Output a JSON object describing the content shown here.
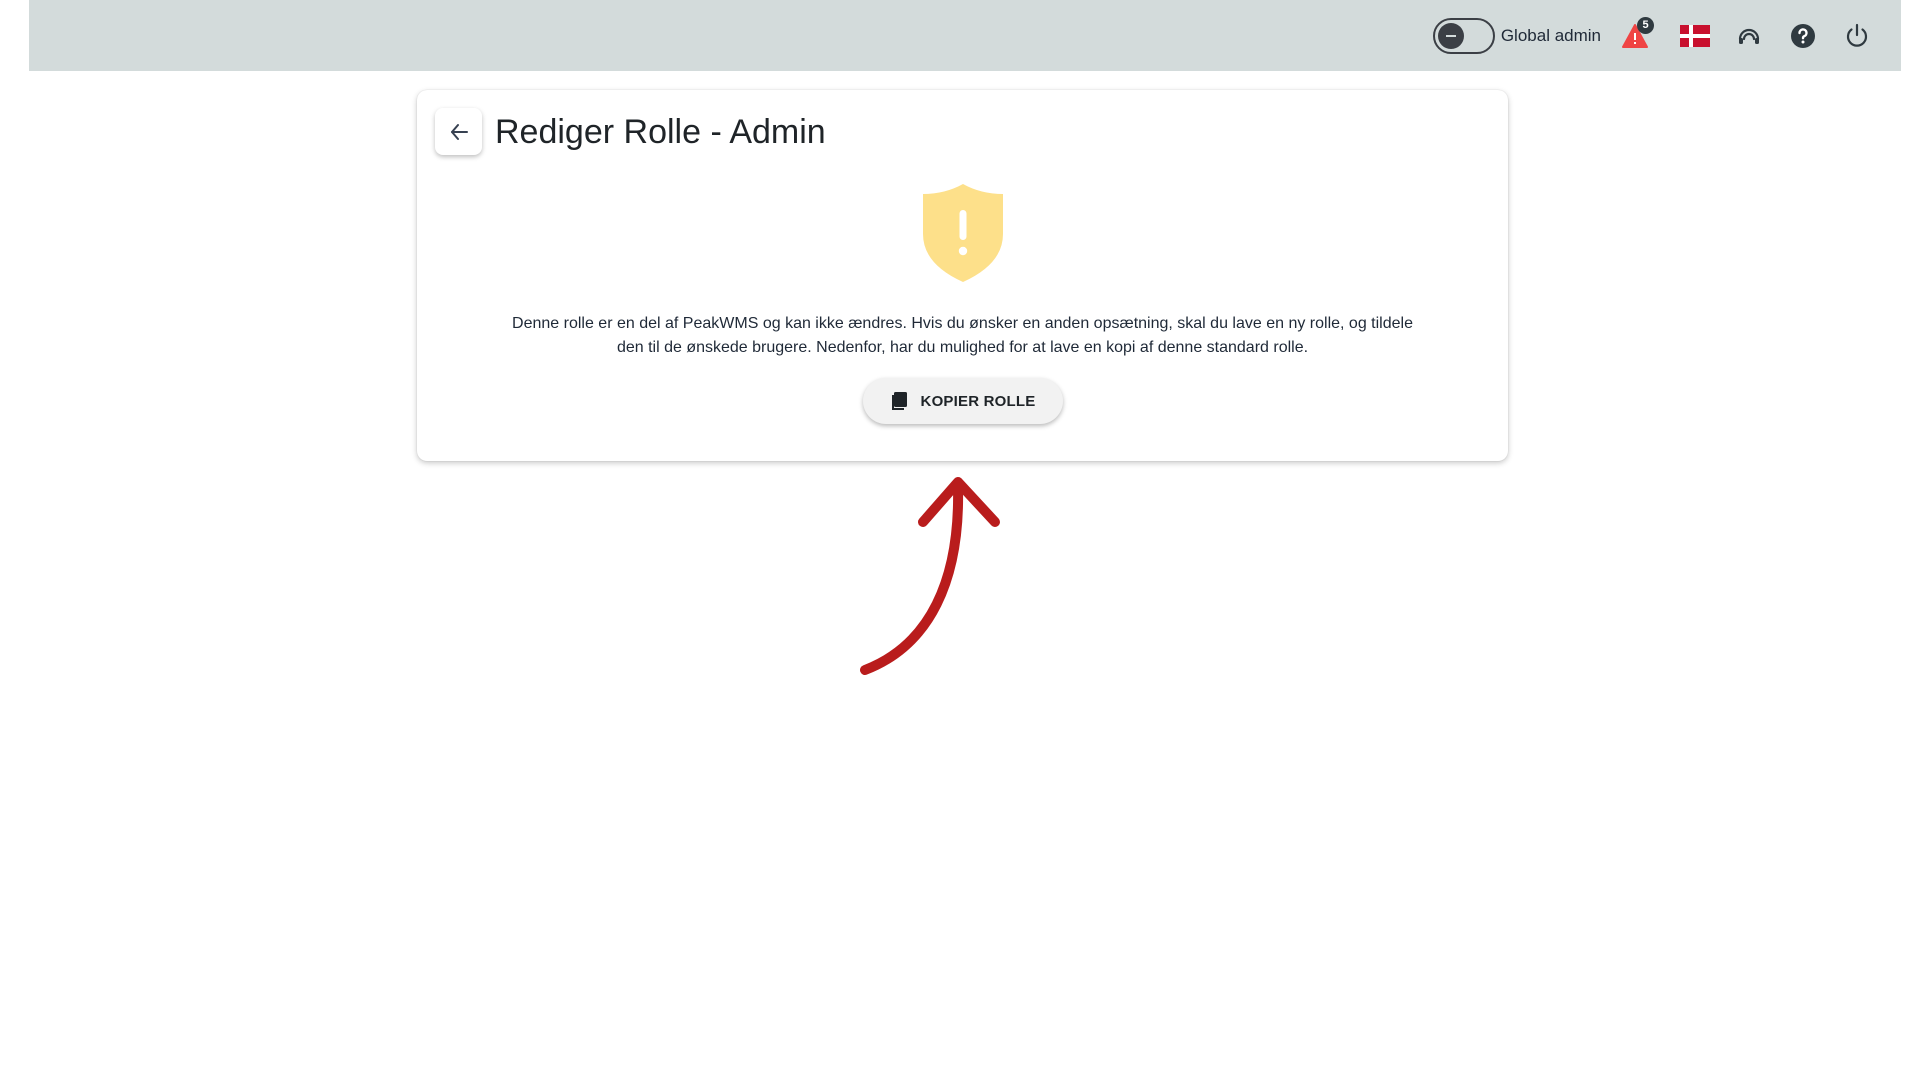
{
  "header": {
    "toggle_label": "Global admin",
    "alert_count": "5",
    "icons": {
      "toggle": "toggle-switch-icon",
      "alert": "warning-triangle-icon",
      "flag": "danish-flag-icon",
      "support": "headset-support-icon",
      "help": "help-circle-icon",
      "power": "power-icon"
    }
  },
  "card": {
    "back_icon": "arrow-left-icon",
    "title": "Rediger Rolle - Admin",
    "shield_icon": "shield-exclamation-icon",
    "notice_line1": "Denne rolle er en del af PeakWMS og kan ikke ændres. Hvis du ønsker en anden opsætning, skal du lave en ny rolle, og tildele",
    "notice_line2": "den til de ønskede brugere. Nedenfor, har du mulighed for at lave en kopi af denne standard rolle.",
    "copy_button_label": "KOPIER ROLLE",
    "copy_icon": "copy-icon"
  },
  "colors": {
    "topbar": "#d3dbdb",
    "shield": "#fde08a",
    "alert": "#ef4444",
    "flag_red": "#c8102e",
    "annotation": "#b91c1c"
  }
}
